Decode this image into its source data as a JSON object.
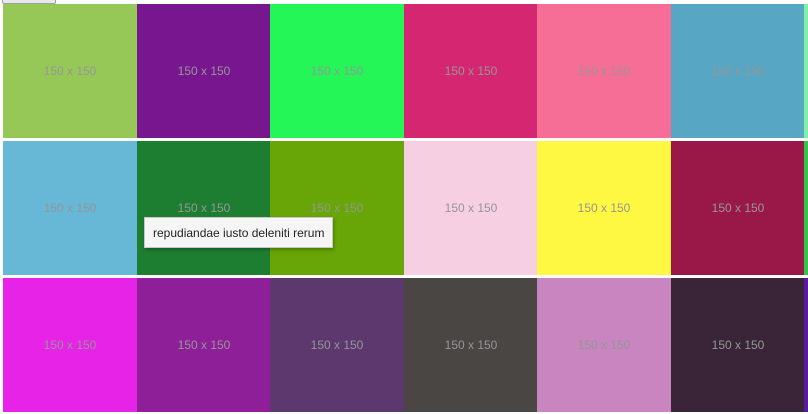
{
  "top_button": {
    "label": ""
  },
  "tiles": {
    "rows": [
      {
        "items": [
          {
            "label": "150 x 150",
            "color": "#96c857"
          },
          {
            "label": "150 x 150",
            "color": "#781690"
          },
          {
            "label": "150 x 150",
            "color": "#25f657"
          },
          {
            "label": "150 x 150",
            "color": "#d52672"
          },
          {
            "label": "150 x 150",
            "color": "#f66e95"
          },
          {
            "label": "150 x 150",
            "color": "#57a6c4"
          },
          {
            "label": "",
            "color": "#7ef0a8"
          }
        ]
      },
      {
        "items": [
          {
            "label": "150 x 150",
            "color": "#67b8d6"
          },
          {
            "label": "150 x 150",
            "color": "#1d7d31"
          },
          {
            "label": "150 x 150",
            "color": "#68a506"
          },
          {
            "label": "150 x 150",
            "color": "#f7cfe3"
          },
          {
            "label": "150 x 150",
            "color": "#fff843"
          },
          {
            "label": "150 x 150",
            "color": "#9a1848"
          },
          {
            "label": "",
            "color": "#2ec84a"
          }
        ]
      },
      {
        "items": [
          {
            "label": "150 x 150",
            "color": "#e723e8"
          },
          {
            "label": "150 x 150",
            "color": "#8e1f98"
          },
          {
            "label": "150 x 150",
            "color": "#5c386f"
          },
          {
            "label": "150 x 150",
            "color": "#494643"
          },
          {
            "label": "150 x 150",
            "color": "#c885c0"
          },
          {
            "label": "150 x 150",
            "color": "#3a2538"
          },
          {
            "label": "",
            "color": "#5a1aa0"
          }
        ]
      }
    ]
  },
  "tooltip": {
    "text": "repudiandae iusto deleniti rerum"
  }
}
